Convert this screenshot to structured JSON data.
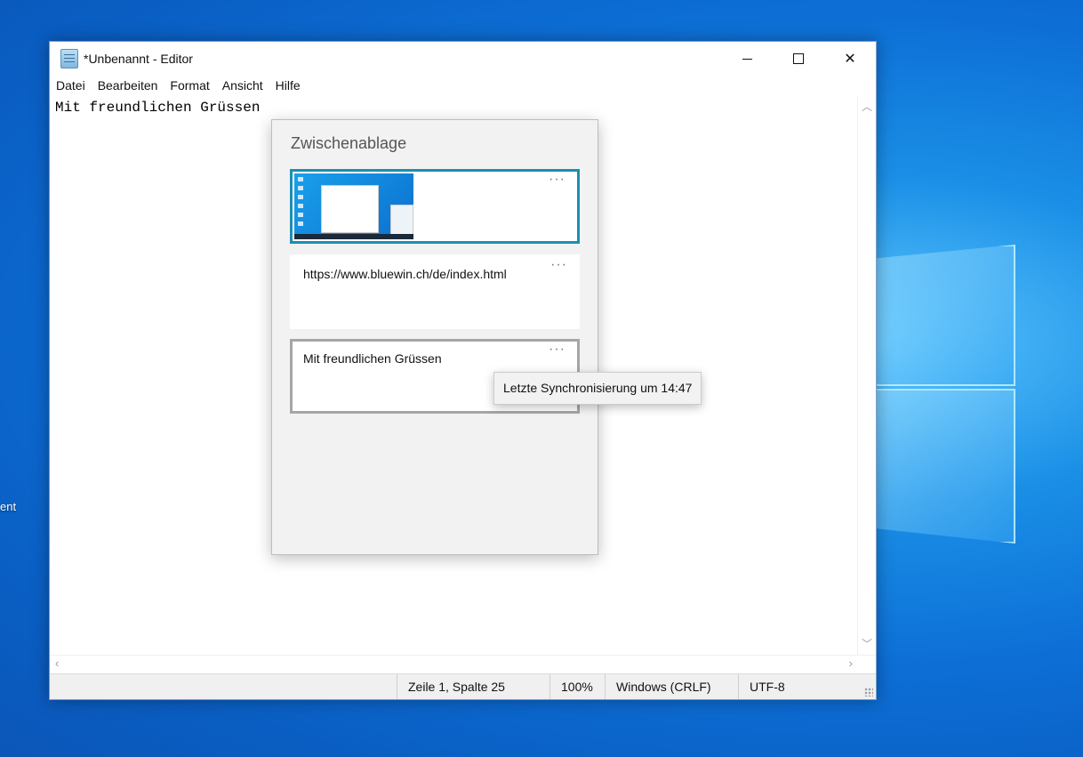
{
  "desktop": {
    "partial_label": "ent"
  },
  "window": {
    "title": "*Unbenannt - Editor",
    "controls": {
      "minimize": "minimize",
      "maximize": "maximize",
      "close": "✕"
    }
  },
  "menu": {
    "items": [
      "Datei",
      "Bearbeiten",
      "Format",
      "Ansicht",
      "Hilfe"
    ]
  },
  "editor": {
    "content": "Mit freundlichen Grüssen"
  },
  "statusbar": {
    "position": "Zeile 1, Spalte 25",
    "zoom": "100%",
    "line_ending": "Windows (CRLF)",
    "encoding": "UTF-8"
  },
  "clipboard": {
    "title": "Zwischenablage",
    "items": [
      {
        "type": "image",
        "more": "···"
      },
      {
        "type": "text",
        "text": "https://www.bluewin.ch/de/index.html",
        "more": "···"
      },
      {
        "type": "text",
        "text": "Mit freundlichen Grüssen",
        "more": "···"
      }
    ],
    "tooltip": "Letzte Synchronisierung um 14:47"
  },
  "colors": {
    "selected_border": "#1a8fb5",
    "hover_border": "#a6a6a6",
    "desktop_blue": "#0d6fd6"
  }
}
